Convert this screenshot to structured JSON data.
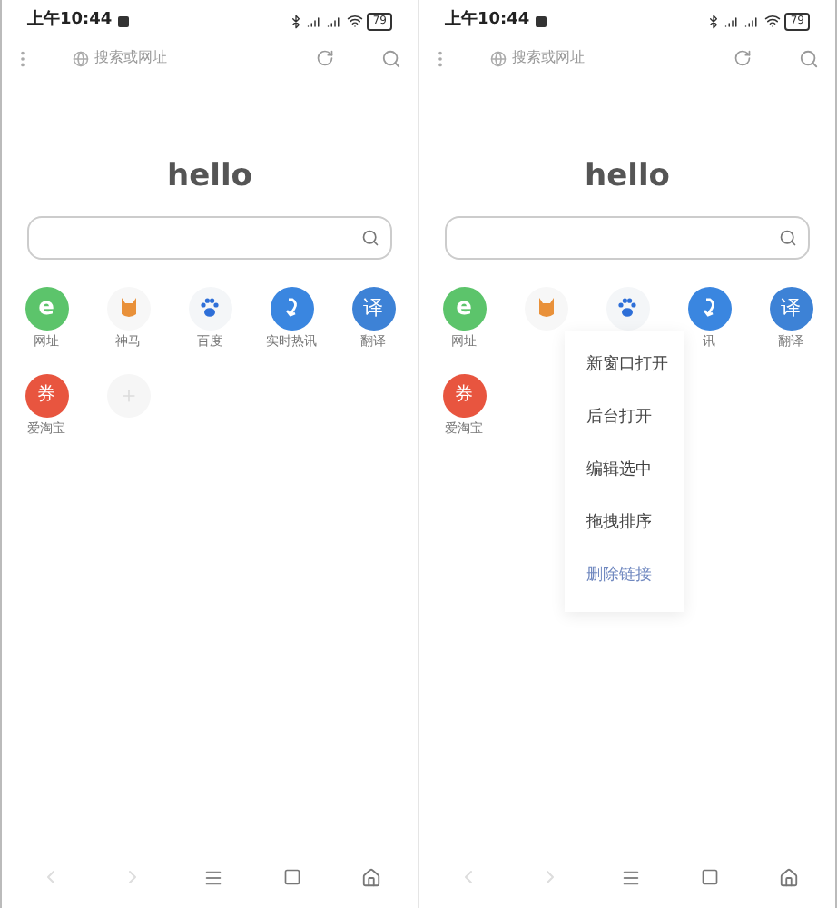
{
  "screens": [
    {
      "status_bar": {
        "time": "上午10:44",
        "battery": "79"
      },
      "toolbar": {
        "placeholder": "搜索或网址"
      },
      "heading": "hello",
      "shortcuts": [
        {
          "kind": "web",
          "glyph": "e",
          "label": "网址"
        },
        {
          "kind": "fox",
          "label": "神马"
        },
        {
          "kind": "paw",
          "label": "百度"
        },
        {
          "kind": "arrow",
          "label": "实时热讯"
        },
        {
          "kind": "translate",
          "glyph": "译",
          "label": "翻译"
        },
        {
          "kind": "coupon",
          "glyph": "券",
          "label": "爱淘宝"
        },
        {
          "kind": "add"
        }
      ]
    },
    {
      "status_bar": {
        "time": "上午10:44",
        "battery": "79"
      },
      "toolbar": {
        "placeholder": "搜索或网址"
      },
      "heading": "hello",
      "shortcuts": [
        {
          "kind": "web",
          "glyph": "e",
          "label": "网址"
        },
        {
          "kind": "fox"
        },
        {
          "kind": "paw"
        },
        {
          "kind": "arrow",
          "label": "讯"
        },
        {
          "kind": "translate",
          "glyph": "译",
          "label": "翻译"
        },
        {
          "kind": "coupon",
          "glyph": "券",
          "label": "爱淘宝"
        }
      ],
      "context_menu": [
        {
          "kind": "normal",
          "label": "新窗口打开"
        },
        {
          "kind": "normal",
          "label": "后台打开"
        },
        {
          "kind": "normal",
          "label": "编辑选中"
        },
        {
          "kind": "normal",
          "label": "拖拽排序"
        },
        {
          "kind": "accent",
          "label": "删除链接"
        }
      ]
    }
  ]
}
